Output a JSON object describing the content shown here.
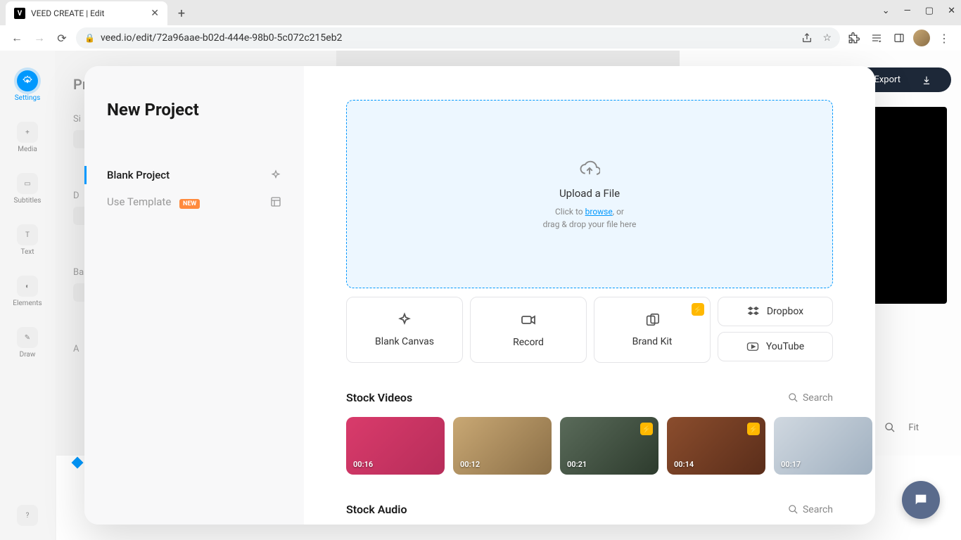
{
  "browser": {
    "tab_title": "VEED CREATE | Edit",
    "url": "veed.io/edit/72a96aae-b02d-444e-98b0-5c072c215eb2"
  },
  "rail": {
    "items": [
      "Settings",
      "Media",
      "Subtitles",
      "Text",
      "Elements",
      "Draw"
    ]
  },
  "bg_panel": {
    "title": "Pr",
    "labels": [
      "Si",
      "D",
      "Ba",
      "A"
    ]
  },
  "export_label": "Export",
  "modal": {
    "title": "New Project",
    "side": {
      "blank": "Blank Project",
      "template": "Use Template",
      "template_badge": "NEW"
    },
    "dropzone": {
      "title": "Upload a File",
      "sub_prefix": "Click to ",
      "sub_link": "browse",
      "sub_suffix": ", or",
      "sub_line2": "drag & drop your file here"
    },
    "options": {
      "blank_canvas": "Blank Canvas",
      "record": "Record",
      "brand_kit": "Brand Kit",
      "dropbox": "Dropbox",
      "youtube": "YouTube"
    },
    "stock_videos": {
      "title": "Stock Videos",
      "search": "Search",
      "items": [
        {
          "duration": "00:16",
          "premium": false
        },
        {
          "duration": "00:12",
          "premium": false
        },
        {
          "duration": "00:21",
          "premium": true
        },
        {
          "duration": "00:14",
          "premium": true
        },
        {
          "duration": "00:17",
          "premium": false
        }
      ]
    },
    "stock_audio": {
      "title": "Stock Audio",
      "search": "Search"
    }
  },
  "zoom_label": "Fit"
}
